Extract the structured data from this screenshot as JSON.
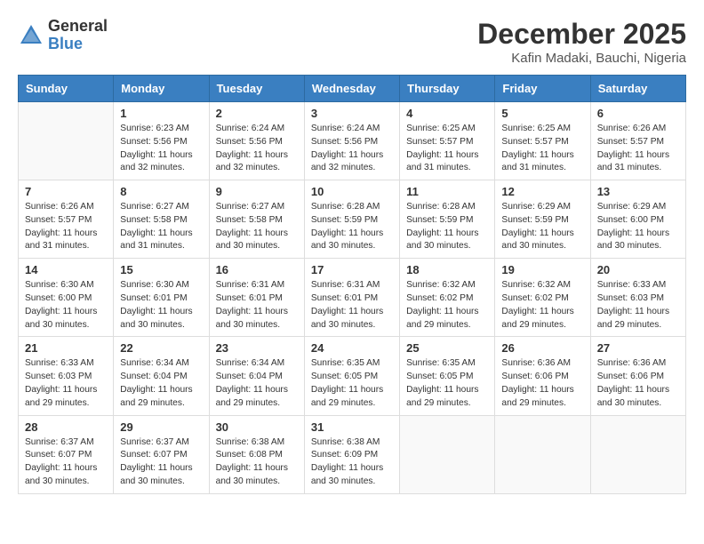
{
  "logo": {
    "general": "General",
    "blue": "Blue"
  },
  "title": "December 2025",
  "subtitle": "Kafin Madaki, Bauchi, Nigeria",
  "days": [
    "Sunday",
    "Monday",
    "Tuesday",
    "Wednesday",
    "Thursday",
    "Friday",
    "Saturday"
  ],
  "weeks": [
    [
      {
        "day": "",
        "content": ""
      },
      {
        "day": "1",
        "content": "Sunrise: 6:23 AM\nSunset: 5:56 PM\nDaylight: 11 hours\nand 32 minutes."
      },
      {
        "day": "2",
        "content": "Sunrise: 6:24 AM\nSunset: 5:56 PM\nDaylight: 11 hours\nand 32 minutes."
      },
      {
        "day": "3",
        "content": "Sunrise: 6:24 AM\nSunset: 5:56 PM\nDaylight: 11 hours\nand 32 minutes."
      },
      {
        "day": "4",
        "content": "Sunrise: 6:25 AM\nSunset: 5:57 PM\nDaylight: 11 hours\nand 31 minutes."
      },
      {
        "day": "5",
        "content": "Sunrise: 6:25 AM\nSunset: 5:57 PM\nDaylight: 11 hours\nand 31 minutes."
      },
      {
        "day": "6",
        "content": "Sunrise: 6:26 AM\nSunset: 5:57 PM\nDaylight: 11 hours\nand 31 minutes."
      }
    ],
    [
      {
        "day": "7",
        "content": "Sunrise: 6:26 AM\nSunset: 5:57 PM\nDaylight: 11 hours\nand 31 minutes."
      },
      {
        "day": "8",
        "content": "Sunrise: 6:27 AM\nSunset: 5:58 PM\nDaylight: 11 hours\nand 31 minutes."
      },
      {
        "day": "9",
        "content": "Sunrise: 6:27 AM\nSunset: 5:58 PM\nDaylight: 11 hours\nand 30 minutes."
      },
      {
        "day": "10",
        "content": "Sunrise: 6:28 AM\nSunset: 5:59 PM\nDaylight: 11 hours\nand 30 minutes."
      },
      {
        "day": "11",
        "content": "Sunrise: 6:28 AM\nSunset: 5:59 PM\nDaylight: 11 hours\nand 30 minutes."
      },
      {
        "day": "12",
        "content": "Sunrise: 6:29 AM\nSunset: 5:59 PM\nDaylight: 11 hours\nand 30 minutes."
      },
      {
        "day": "13",
        "content": "Sunrise: 6:29 AM\nSunset: 6:00 PM\nDaylight: 11 hours\nand 30 minutes."
      }
    ],
    [
      {
        "day": "14",
        "content": "Sunrise: 6:30 AM\nSunset: 6:00 PM\nDaylight: 11 hours\nand 30 minutes."
      },
      {
        "day": "15",
        "content": "Sunrise: 6:30 AM\nSunset: 6:01 PM\nDaylight: 11 hours\nand 30 minutes."
      },
      {
        "day": "16",
        "content": "Sunrise: 6:31 AM\nSunset: 6:01 PM\nDaylight: 11 hours\nand 30 minutes."
      },
      {
        "day": "17",
        "content": "Sunrise: 6:31 AM\nSunset: 6:01 PM\nDaylight: 11 hours\nand 30 minutes."
      },
      {
        "day": "18",
        "content": "Sunrise: 6:32 AM\nSunset: 6:02 PM\nDaylight: 11 hours\nand 29 minutes."
      },
      {
        "day": "19",
        "content": "Sunrise: 6:32 AM\nSunset: 6:02 PM\nDaylight: 11 hours\nand 29 minutes."
      },
      {
        "day": "20",
        "content": "Sunrise: 6:33 AM\nSunset: 6:03 PM\nDaylight: 11 hours\nand 29 minutes."
      }
    ],
    [
      {
        "day": "21",
        "content": "Sunrise: 6:33 AM\nSunset: 6:03 PM\nDaylight: 11 hours\nand 29 minutes."
      },
      {
        "day": "22",
        "content": "Sunrise: 6:34 AM\nSunset: 6:04 PM\nDaylight: 11 hours\nand 29 minutes."
      },
      {
        "day": "23",
        "content": "Sunrise: 6:34 AM\nSunset: 6:04 PM\nDaylight: 11 hours\nand 29 minutes."
      },
      {
        "day": "24",
        "content": "Sunrise: 6:35 AM\nSunset: 6:05 PM\nDaylight: 11 hours\nand 29 minutes."
      },
      {
        "day": "25",
        "content": "Sunrise: 6:35 AM\nSunset: 6:05 PM\nDaylight: 11 hours\nand 29 minutes."
      },
      {
        "day": "26",
        "content": "Sunrise: 6:36 AM\nSunset: 6:06 PM\nDaylight: 11 hours\nand 29 minutes."
      },
      {
        "day": "27",
        "content": "Sunrise: 6:36 AM\nSunset: 6:06 PM\nDaylight: 11 hours\nand 30 minutes."
      }
    ],
    [
      {
        "day": "28",
        "content": "Sunrise: 6:37 AM\nSunset: 6:07 PM\nDaylight: 11 hours\nand 30 minutes."
      },
      {
        "day": "29",
        "content": "Sunrise: 6:37 AM\nSunset: 6:07 PM\nDaylight: 11 hours\nand 30 minutes."
      },
      {
        "day": "30",
        "content": "Sunrise: 6:38 AM\nSunset: 6:08 PM\nDaylight: 11 hours\nand 30 minutes."
      },
      {
        "day": "31",
        "content": "Sunrise: 6:38 AM\nSunset: 6:09 PM\nDaylight: 11 hours\nand 30 minutes."
      },
      {
        "day": "",
        "content": ""
      },
      {
        "day": "",
        "content": ""
      },
      {
        "day": "",
        "content": ""
      }
    ]
  ]
}
